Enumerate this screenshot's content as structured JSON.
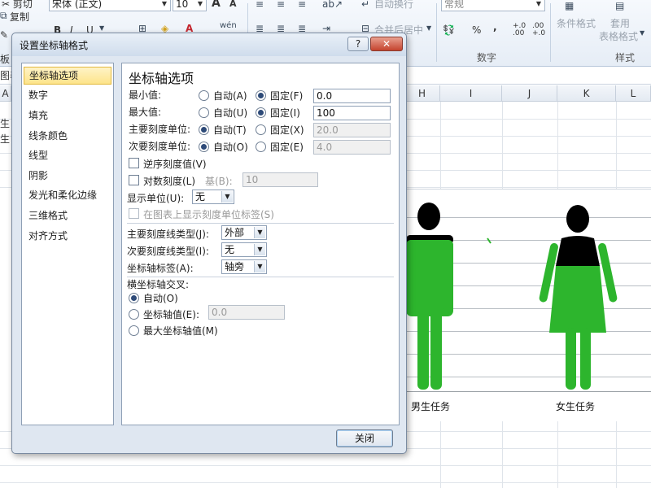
{
  "ribbon": {
    "copy_label": "复制",
    "font_name": "宋体 (正文)",
    "font_size": "10",
    "bold": "B",
    "italic": "I",
    "underline": "U",
    "grow_font": "A",
    "shrink_font": "A",
    "wrap_text": "自动换行",
    "merge_center": "合并后居中",
    "number_format": "常规",
    "percent": "%",
    "comma": ",",
    "increase_decimal": "+.0 .00",
    "decrease_decimal": ".00 +.0",
    "conditional_format": "条件格式",
    "format_table_1": "套用",
    "format_table_2": "表格格式",
    "group_number": "数字",
    "group_style": "样式",
    "left_cut_1": "板",
    "left_cut_2": "图表"
  },
  "grid": {
    "columns": [
      "H",
      "I",
      "J",
      "K",
      "L"
    ],
    "row_text_1": "生",
    "row_text_2": "生",
    "col_a_cut": "A"
  },
  "chart": {
    "categories": [
      "男生任务",
      "女生任务"
    ],
    "figure_colors": {
      "fill": "#2db52d",
      "top": "#000000"
    }
  },
  "dialog": {
    "title": "设置坐标轴格式",
    "help_button": "?",
    "close_x": "✕",
    "nav_items": [
      "坐标轴选项",
      "数字",
      "填充",
      "线条颜色",
      "线型",
      "阴影",
      "发光和柔化边缘",
      "三维格式",
      "对齐方式"
    ],
    "selected_nav": "坐标轴选项",
    "panel_title": "坐标轴选项",
    "min_label": "最小值:",
    "max_label": "最大值:",
    "major_unit_label": "主要刻度单位:",
    "minor_unit_label": "次要刻度单位:",
    "auto_a": "自动(A)",
    "fixed_f": "固定(F)",
    "auto_u": "自动(U)",
    "fixed_i": "固定(I)",
    "auto_t": "自动(T)",
    "fixed_x": "固定(X)",
    "auto_o": "自动(O)",
    "fixed_e": "固定(E)",
    "min_value": "0.0",
    "max_value": "100",
    "major_value": "20.0",
    "minor_value": "4.0",
    "reverse_label": "逆序刻度值(V)",
    "log_label": "对数刻度(L)",
    "base_label": "基(B):",
    "base_value": "10",
    "display_units_label": "显示单位(U):",
    "display_units_value": "无",
    "show_units_label": "在图表上显示刻度单位标签(S)",
    "major_tick_label": "主要刻度线类型(J):",
    "major_tick_value": "外部",
    "minor_tick_label": "次要刻度线类型(I):",
    "minor_tick_value": "无",
    "axis_labels_label": "坐标轴标签(A):",
    "axis_labels_value": "轴旁",
    "cross_title": "横坐标轴交叉:",
    "cross_auto": "自动(O)",
    "cross_value_label": "坐标轴值(E):",
    "cross_value": "0.0",
    "cross_max": "最大坐标轴值(M)",
    "close_button": "关闭"
  }
}
